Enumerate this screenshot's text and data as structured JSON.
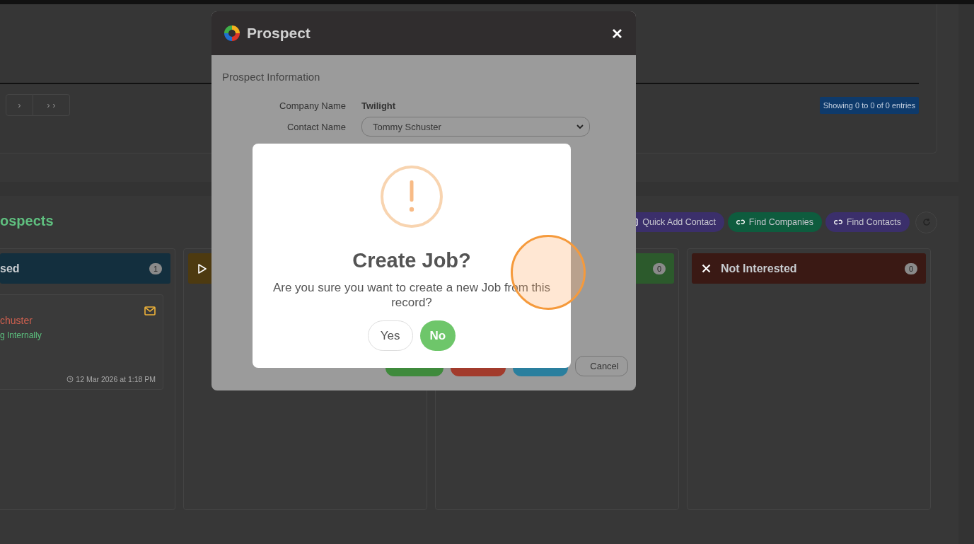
{
  "page": {
    "pagination": [
      "›",
      "› ›"
    ],
    "entries_info": "Showing 0 to 0 of 0 entries",
    "section_title": "ospects",
    "toolbar": [
      {
        "label": "Quick Add Contact",
        "color": "#3b2f6b",
        "kind": "card"
      },
      {
        "label": "Find Companies",
        "color": "#0e5c3e",
        "kind": "link"
      },
      {
        "label": "Find Contacts",
        "color": "#3b2f6b",
        "kind": "link"
      },
      {
        "kind": "refresh"
      }
    ],
    "columns": [
      {
        "title": "sed",
        "count": "1",
        "color": "#132f3e",
        "kind": "plain",
        "cards": [
          {
            "name": "chuster",
            "status": "g Internally",
            "time": "12 Mar 2026 at 1:18 PM"
          }
        ]
      },
      {
        "color": "#4d3a10",
        "kind": "play"
      },
      {
        "count": "0",
        "color": "#2c5a2c",
        "kind": "plain"
      },
      {
        "title": "Not Interested",
        "count": "0",
        "color": "#3a1914",
        "kind": "cross"
      }
    ]
  },
  "prospect_dialog": {
    "title": "Prospect",
    "section": "Prospect Information",
    "fields": [
      {
        "label": "Company Name",
        "value": "Twilight",
        "kind": "text"
      },
      {
        "label": "Contact Name",
        "value": "Tommy Schuster",
        "kind": "select"
      }
    ],
    "buttons": [
      {
        "color": "#3f8a3c",
        "kind": "filled"
      },
      {
        "color": "#a23b2c",
        "kind": "filled"
      },
      {
        "color": "#2a7f9e",
        "kind": "filled"
      },
      {
        "label": "Cancel",
        "kind": "outline"
      }
    ]
  },
  "confirm_dialog": {
    "title": "Create Job?",
    "message": "Are you sure you want to create a new Job from this record?",
    "buttons": [
      {
        "label": "Yes",
        "kind": "plain"
      },
      {
        "label": "No",
        "kind": "primary"
      }
    ]
  }
}
